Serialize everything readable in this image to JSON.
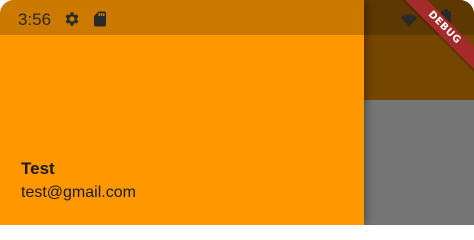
{
  "status_bar": {
    "time": "3:56",
    "icons": [
      "gear-icon",
      "sd-card-icon",
      "wifi-icon",
      "battery-icon"
    ]
  },
  "drawer": {
    "account_name": "Test",
    "account_email": "test@gmail.com"
  },
  "debug_banner": "DEBUG",
  "colors": {
    "primary": "#FF9800",
    "scrim": "#000000",
    "debug": "#A52A2A"
  }
}
